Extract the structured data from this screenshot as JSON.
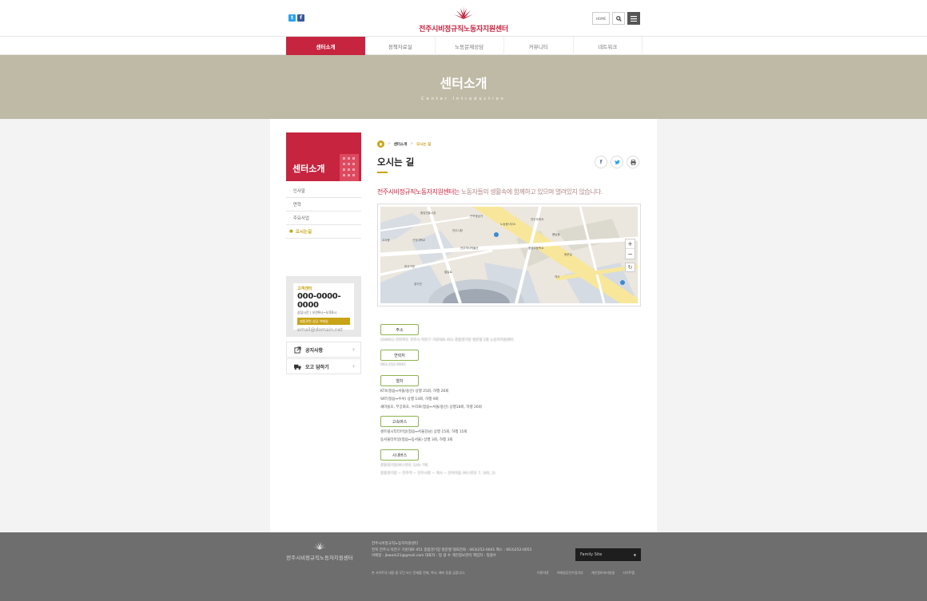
{
  "header": {
    "site_name": "전주시비정규직노동자지원센터",
    "sns": {
      "twitter": "t",
      "facebook": "f"
    },
    "home_label": "HOME",
    "brand_color": "#c7243f",
    "gold_color": "#c9a317"
  },
  "gnb": {
    "items": [
      {
        "label": "센터소개"
      },
      {
        "label": "정책자료실"
      },
      {
        "label": "노동문제상담"
      },
      {
        "label": "커뮤니티"
      },
      {
        "label": "네트워크"
      }
    ],
    "active_index": 0
  },
  "visual": {
    "title": "센터소개",
    "subtitle": "Center Introduction"
  },
  "lnb": {
    "title": "센터소개",
    "items": [
      {
        "label": "인사말"
      },
      {
        "label": "연혁"
      },
      {
        "label": "주요사업"
      },
      {
        "label": "오시는길"
      }
    ],
    "active_index": 3
  },
  "customer_center": {
    "label": "고객센터",
    "phone": "000-0000-0000",
    "hours": "상담시간 | 오전9시~오후6시",
    "email_label": "제품관련 상담 이메일",
    "email": "email@domain.net"
  },
  "quick_links": [
    {
      "label": "공지사항",
      "icon": "external-link-icon"
    },
    {
      "label": "오고 담하기",
      "icon": "truck-icon"
    }
  ],
  "breadcrumb": {
    "level1": "센터소개",
    "level2": "오시는 길"
  },
  "page": {
    "title": "오시는 길",
    "intro_highlight": "전주시비정규직노동자지원센터는",
    "intro_rest": " 노동자들의 생활속에 함께하고 있으며 열려있지 않습니다."
  },
  "map": {
    "labels": [
      "중앙전통시장",
      "진북동상가",
      "노송동사무소",
      "전주시청",
      "전주우체국",
      "풍남동",
      "신앙대학교",
      "고사동",
      "중앙초등학교",
      "동문길",
      "전주역사박물관",
      "완산구청",
      "팔달로",
      "경기전",
      "객사"
    ]
  },
  "info": {
    "sections": [
      {
        "tag": "주소",
        "lines": [
          "(54941) 전라북도 전주시 덕진구 기린대로 451 종합경기장 정문옆 2층 노동자지원센터"
        ],
        "blur": true
      },
      {
        "tag": "연락처",
        "lines": [
          "063-252-0041"
        ],
        "blur": true
      },
      {
        "tag": "열차",
        "lines": [
          "KTX(정읍↔서울/용산) 상행 25회, 하행 26회",
          "SRT(정읍↔수서) 상행 14회, 하행 9회",
          "새마을호, 무궁화호, 누리로(정읍↔서울/용산) 상행18회, 하행 26회"
        ],
        "blur": false
      },
      {
        "tag": "고속버스",
        "lines": [
          "센트럴시티터미널(정읍↔서울강남) 상행 15회, 하행 15회",
          "동서울터미널(정읍↔동서울) 상행 3회, 하행 3회"
        ],
        "blur": false
      },
      {
        "tag": "시내버스",
        "lines": [
          "종합경기장(버스번호 124) 7회",
          "종합경기장 ~ 전주역 ~ 전주시청 ~ 객사 ~ 한옥마을 (버스번호 7, 165, 2)"
        ],
        "blur": true
      }
    ]
  },
  "footer": {
    "name": "전주시비정규직노동자지원센터",
    "info1": "전주시비정규직노동자지원센터",
    "info2": "전북 전주시 덕진구 기린대로 451 종합경기장 정문옆   대표전화 : 063)252-0041   팩스 : 063)252-0051",
    "info3": "이메일 : jbwork21@gmail.com   대표자 : 정 광 수   개인정보관리 책임자 : 정광수",
    "family_site": "Family Site",
    "copyright": "본 사이트의 내용 중 무단 또는 전재를 전재, 복사, 배포 등을 금합니다.",
    "links": [
      "이용약관",
      "이메일무단수집거부",
      "개인정보처리방침",
      "사이트맵"
    ]
  }
}
